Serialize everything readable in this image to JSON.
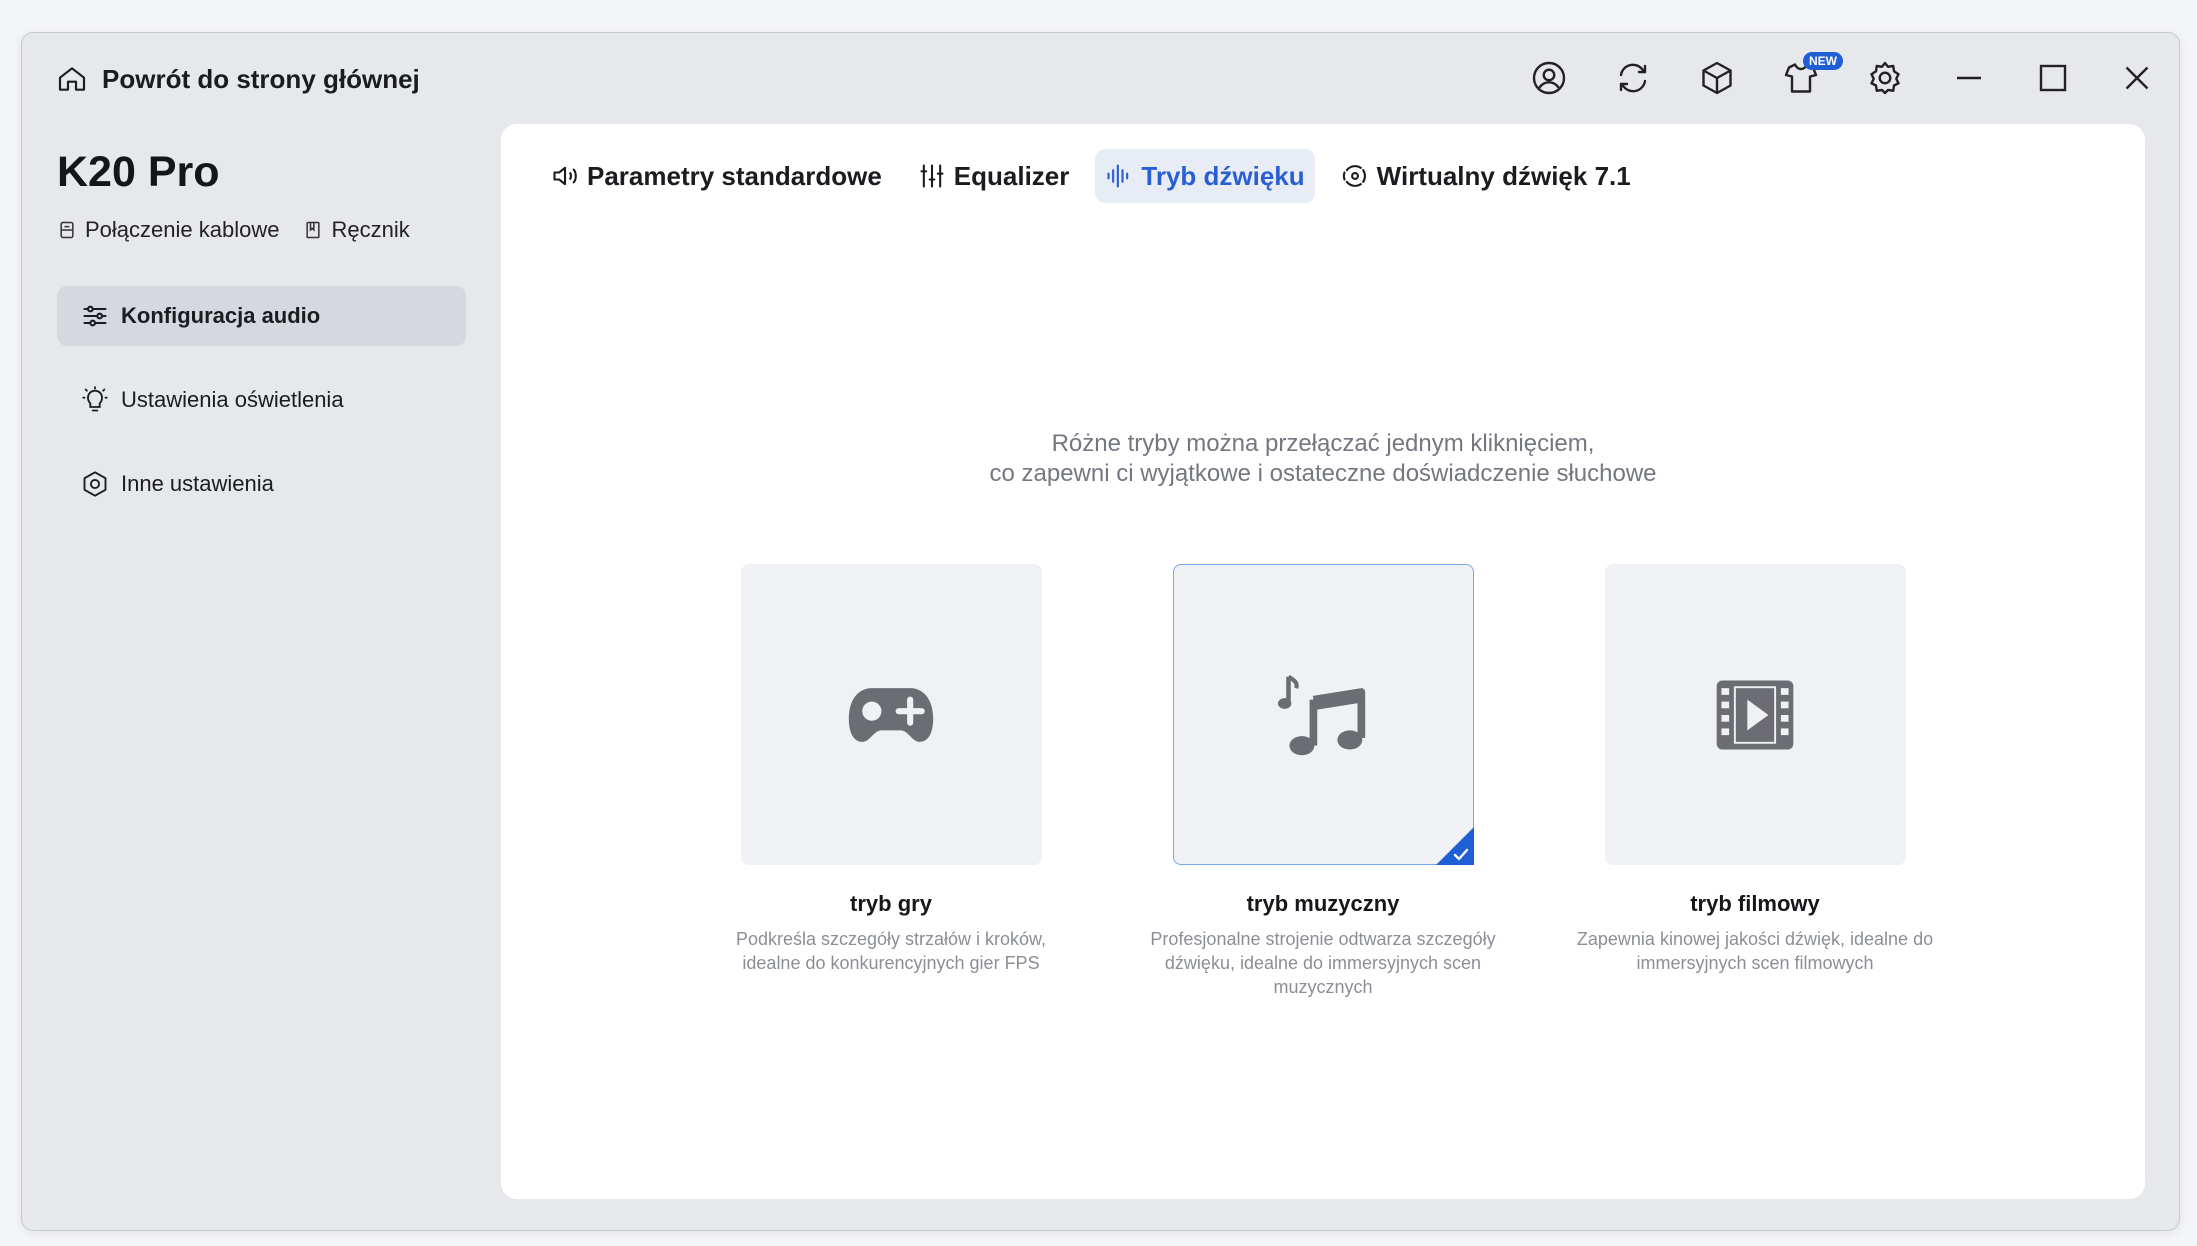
{
  "titlebar": {
    "back_label": "Powrót do strony głównej",
    "icons": [
      "user-icon",
      "sync-icon",
      "cube-icon",
      "shirt-icon",
      "settings-icon",
      "minimize-icon",
      "maximize-icon",
      "close-icon"
    ],
    "new_badge": "NEW"
  },
  "device": {
    "name": "K20 Pro",
    "connection": "Połączenie kablowe",
    "manual": "Ręcznik"
  },
  "sidebar": {
    "items": [
      {
        "label": "Konfiguracja audio",
        "active": true
      },
      {
        "label": "Ustawienia oświetlenia",
        "active": false
      },
      {
        "label": "Inne ustawienia",
        "active": false
      }
    ]
  },
  "tabs": [
    {
      "label": "Parametry standardowe",
      "active": false
    },
    {
      "label": "Equalizer",
      "active": false
    },
    {
      "label": "Tryb dźwięku",
      "active": true
    },
    {
      "label": "Wirtualny dźwięk 7.1",
      "active": false
    }
  ],
  "intro": {
    "line1": "Różne tryby można przełączać jednym kliknięciem,",
    "line2": "co zapewni ci wyjątkowe i ostateczne doświadczenie słuchowe"
  },
  "modes": [
    {
      "title": "tryb gry",
      "desc": "Podkreśla szczegóły strzałów i kroków, idealne do konkurencyjnych gier FPS",
      "icon": "gamepad-icon",
      "selected": false
    },
    {
      "title": "tryb muzyczny",
      "desc": "Profesjonalne strojenie odtwarza szczegóły dźwięku, idealne do immersyjnych scen muzycznych",
      "icon": "music-note-icon",
      "selected": true
    },
    {
      "title": "tryb filmowy",
      "desc": "Zapewnia kinowej jakości dźwięk, idealne do immersyjnych scen filmowych",
      "icon": "film-icon",
      "selected": false
    }
  ],
  "colors": {
    "accent": "#2a5fd4",
    "badge": "#1f5fd6",
    "selected_border": "#7aa6ee"
  }
}
